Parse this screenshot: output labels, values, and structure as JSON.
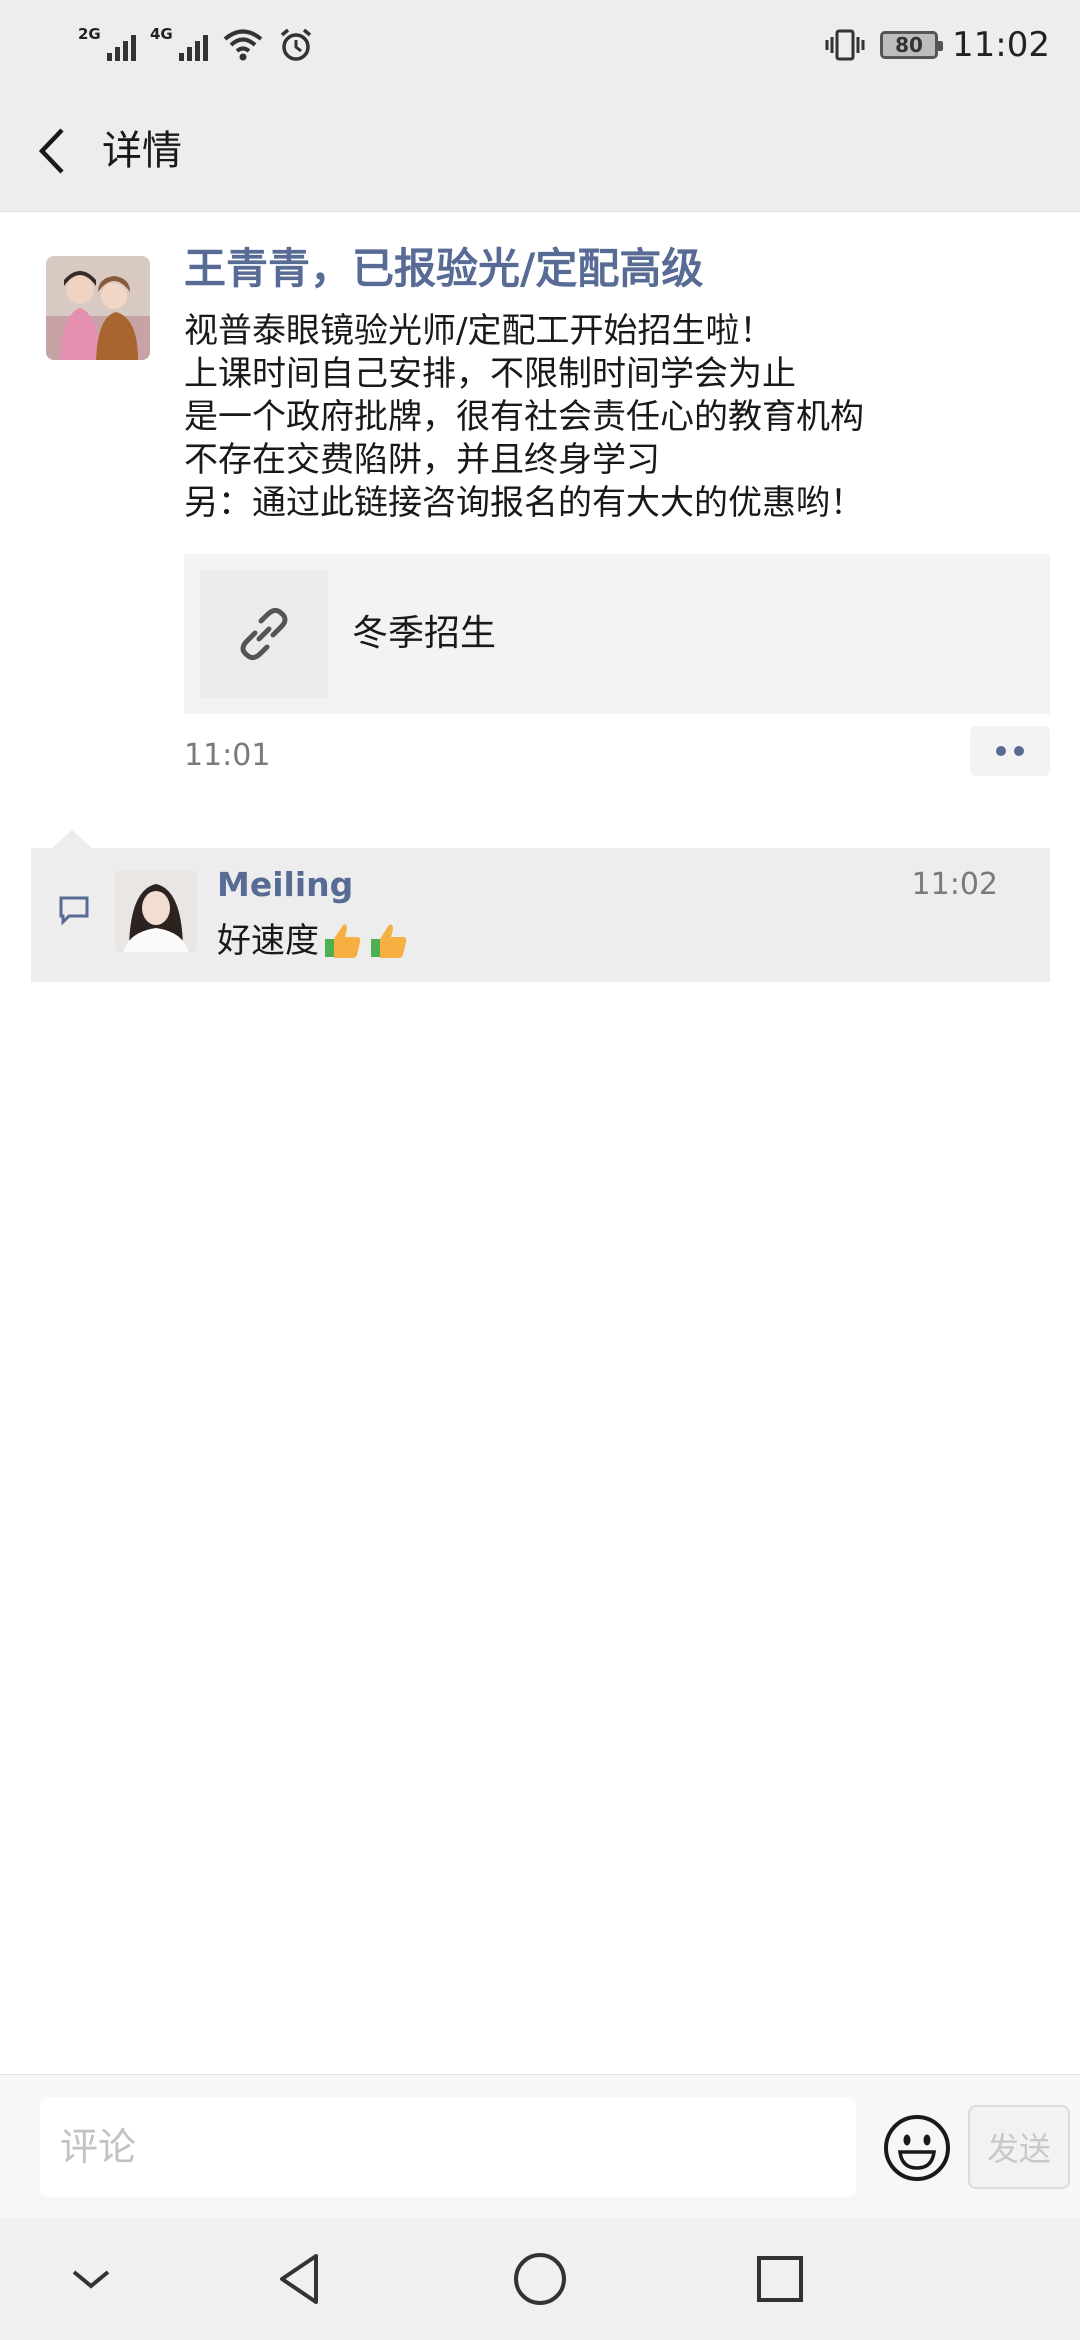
{
  "status_bar": {
    "signal1_label": "2G",
    "signal2_label": "4G",
    "battery": "80",
    "time": "11:02"
  },
  "header": {
    "title": "详情"
  },
  "post": {
    "author": "王青青，已报验光/定配高级",
    "lines": [
      "视普泰眼镜验光师/定配工开始招生啦！",
      "上课时间自己安排，不限制时间学会为止",
      "是一个政府批牌，很有社会责任心的教育机构",
      "不存在交费陷阱，并且终身学习",
      "另：通过此链接咨询报名的有大大的优惠哟！"
    ],
    "link_title": "冬季招生",
    "time": "11:01"
  },
  "comment": {
    "author": "Meiling",
    "time": "11:02",
    "text": "好速度"
  },
  "input_bar": {
    "placeholder": "评论",
    "send_label": "发送"
  },
  "colors": {
    "accent_link": "#576b95",
    "header_bg": "#ededed",
    "comment_bg": "#ededed"
  }
}
